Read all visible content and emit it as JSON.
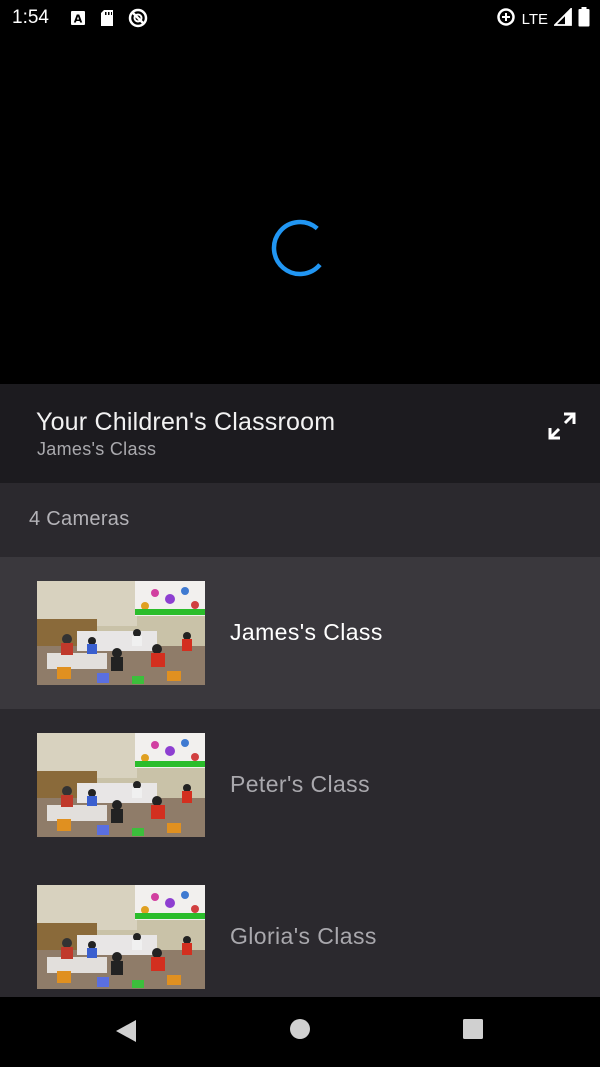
{
  "status_bar": {
    "time": "1:54",
    "left_icons": [
      "a-box-icon",
      "sd-card-icon",
      "no-signal-circle-icon"
    ],
    "network": "LTE",
    "right_icons": [
      "data-saver-icon",
      "signal-icon",
      "battery-icon"
    ]
  },
  "video": {
    "state": "loading",
    "spinner_color": "#2196f3"
  },
  "header": {
    "title": "Your Children's Classroom",
    "subtitle": "James's Class",
    "fullscreen_icon": "fullscreen-expand-icon"
  },
  "cameras": {
    "count_label": "4 Cameras",
    "items": [
      {
        "name": "James's Class",
        "selected": true
      },
      {
        "name": "Peter's Class",
        "selected": false
      },
      {
        "name": "Gloria's Class",
        "selected": false
      }
    ]
  },
  "nav": {
    "back_icon": "back-triangle-icon",
    "home_icon": "home-circle-icon",
    "recents_icon": "recents-square-icon"
  },
  "colors": {
    "header_bg": "#1c1b1f",
    "list_bg": "#2b292e",
    "selected_bg": "#3a383d",
    "accent": "#2196f3"
  }
}
